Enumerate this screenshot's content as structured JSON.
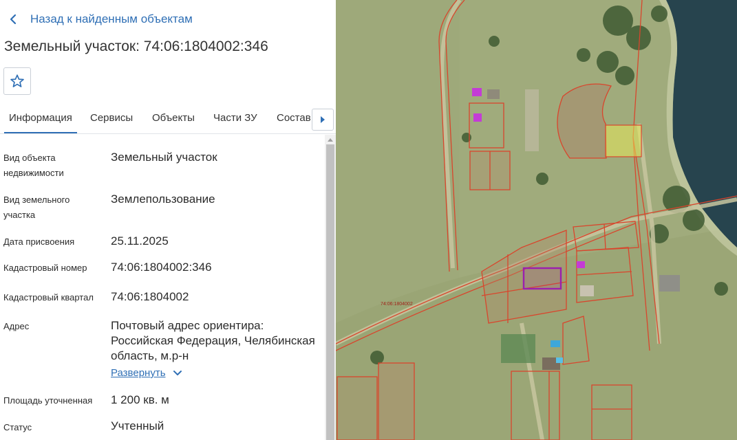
{
  "back_link": {
    "label": "Назад к найденным объектам"
  },
  "title": "Земельный участок: 74:06:1804002:346",
  "favorite": {
    "icon": "star-icon"
  },
  "tabs": [
    {
      "label": "Информация",
      "active": true
    },
    {
      "label": "Сервисы",
      "active": false
    },
    {
      "label": "Объекты",
      "active": false
    },
    {
      "label": "Части ЗУ",
      "active": false
    },
    {
      "label": "Состав",
      "active": false
    }
  ],
  "details": {
    "object_type": {
      "label": "Вид объекта недвижимости",
      "value": "Земельный участок"
    },
    "land_type": {
      "label": "Вид земельного участка",
      "value": "Землепользование"
    },
    "assigned_date": {
      "label": "Дата присвоения",
      "value": "25.11.2025"
    },
    "cadastral_number": {
      "label": "Кадастровый номер",
      "value": "74:06:1804002:346"
    },
    "cadastral_block": {
      "label": "Кадастровый квартал",
      "value": "74:06:1804002"
    },
    "address": {
      "label": "Адрес",
      "value": "Почтовый адрес ориентира: Российская Федерация, Челябинская область, м.р-н",
      "expand_label": "Развернуть"
    },
    "area": {
      "label": "Площадь уточненная",
      "value": "1 200 кв. м"
    },
    "status": {
      "label": "Статус",
      "value": "Учтенный"
    }
  },
  "map": {
    "quarter_label": "74:06:1804002"
  },
  "colors": {
    "link": "#2f6fb5",
    "parcel_border": "#d9452c",
    "selected_parcel": "#9b1fae",
    "highlight_fill": "#e6e85a",
    "water": "#27444e"
  }
}
